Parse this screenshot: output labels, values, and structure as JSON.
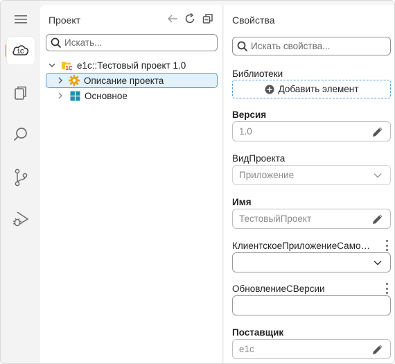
{
  "activity_bar": {
    "items": [
      {
        "name": "menu-icon"
      },
      {
        "name": "1c-cloud-icon",
        "active": true
      },
      {
        "name": "files-icon"
      },
      {
        "name": "search-icon"
      },
      {
        "name": "source-control-icon"
      },
      {
        "name": "run-debug-icon"
      }
    ],
    "accent_color": "#f2c81b"
  },
  "project": {
    "title": "Проект",
    "search_placeholder": "Искать...",
    "tree": [
      {
        "label": "e1c::Тестовый проект 1.0",
        "expanded": true,
        "icon": "1c-folder-icon"
      },
      {
        "label": "Описание проекта",
        "selected": true,
        "icon": "gear-icon"
      },
      {
        "label": "Основное",
        "icon": "grid-icon"
      }
    ]
  },
  "properties": {
    "title": "Свойства",
    "search_placeholder": "Искать свойства...",
    "libraries_label": "Библиотеки",
    "add_element_label": "Добавить элемент",
    "version_label": "Версия",
    "version_value": "1.0",
    "project_type_label": "ВидПроекта",
    "project_type_value": "Приложение",
    "name_label": "Имя",
    "name_value": "ТестовыйПроект",
    "client_app_label": "КлиентскоеПриложениеСамост...",
    "client_app_value": "",
    "update_label": "ОбновлениеСВерсии",
    "update_value": "",
    "vendor_label": "Поставщик",
    "vendor_value": "e1c"
  },
  "colors": {
    "selection_bg": "#e3f1fb",
    "selection_border": "#4a9bd8",
    "1c_red": "#d82c20",
    "1c_yellow": "#f5c518",
    "gear_yellow": "#e8a317",
    "grid_teal": "#1f8fae"
  }
}
